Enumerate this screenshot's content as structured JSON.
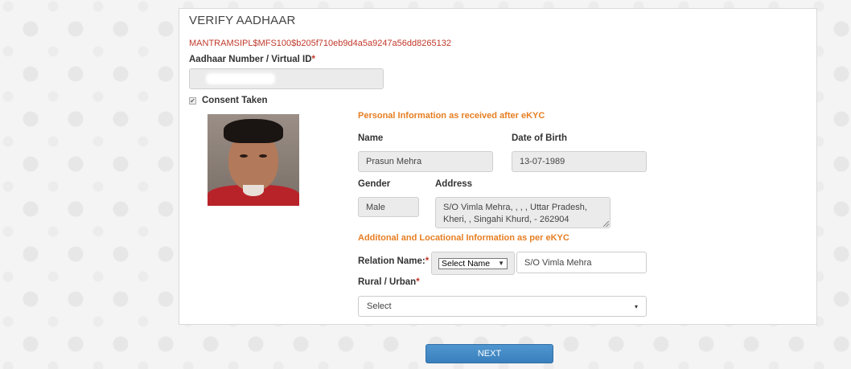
{
  "header": {
    "title": "VERIFY AADHAAR",
    "device_id": "MANTRAMSIPL$MFS100$b205f710eb9d4a5a9247a56dd8265132"
  },
  "aadhaar": {
    "label": "Aadhaar Number / Virtual ID",
    "required_mark": "*"
  },
  "consent": {
    "label": "Consent Taken",
    "checked": true,
    "check_glyph": "✔"
  },
  "personal": {
    "section_title": "Personal Information as received after eKYC",
    "name_label": "Name",
    "name_value": "Prasun Mehra",
    "dob_label": "Date of Birth",
    "dob_value": "13-07-1989",
    "gender_label": "Gender",
    "gender_value": "Male",
    "address_label": "Address",
    "address_line1": "S/O Vimla Mehra, , , , Uttar Pradesh,",
    "address_line2": "Kheri, , Singahi Khurd,  - 262904"
  },
  "additional": {
    "section_title": "Additonal and Locational Information as per eKYC",
    "relation_label": "Relation Name:",
    "relation_required": "*",
    "relation_select": "Select Name",
    "relation_value": "S/O Vimla Mehra",
    "rural_urban_label": "Rural / Urban",
    "rural_urban_required": "*",
    "rural_urban_select": "Select"
  },
  "actions": {
    "next_label": "NEXT"
  },
  "icons": {
    "select_caret": "▼",
    "rural_caret": "▾"
  }
}
